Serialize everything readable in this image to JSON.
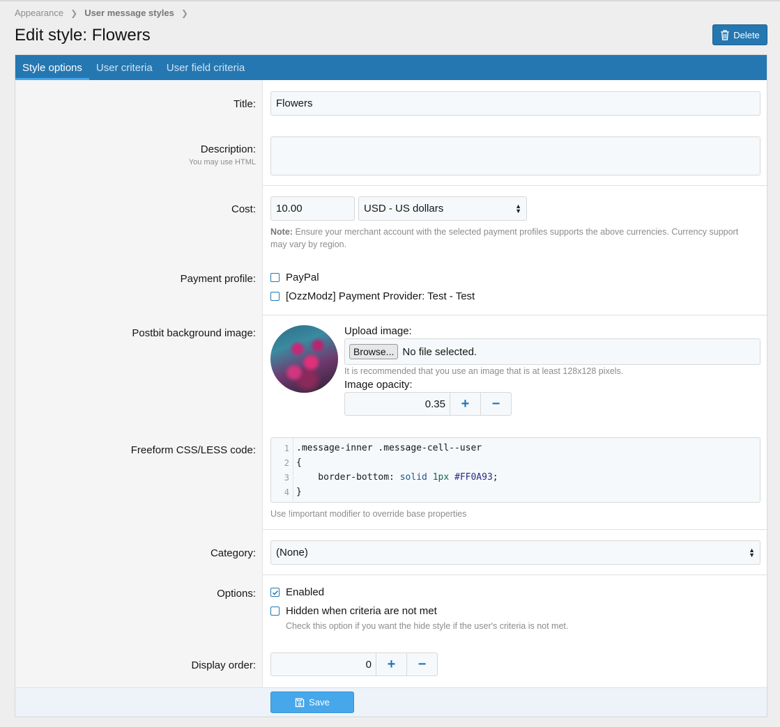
{
  "breadcrumb": {
    "items": [
      "Appearance",
      "User message styles"
    ]
  },
  "page": {
    "title": "Edit style: Flowers",
    "delete_label": "Delete"
  },
  "tabs": [
    "Style options",
    "User criteria",
    "User field criteria"
  ],
  "form": {
    "title": {
      "label": "Title:",
      "value": "Flowers"
    },
    "description": {
      "label": "Description:",
      "sublabel": "You may use HTML",
      "value": ""
    },
    "cost": {
      "label": "Cost:",
      "value": "10.00",
      "currency": "USD - US dollars",
      "note_bold": "Note:",
      "note": "Ensure your merchant account with the selected payment profiles supports the above currencies. Currency support may vary by region."
    },
    "payment_profile": {
      "label": "Payment profile:",
      "options": [
        {
          "label": "PayPal",
          "checked": false
        },
        {
          "label": "[OzzModz] Payment Provider: Test - Test",
          "checked": false
        }
      ]
    },
    "postbit": {
      "label": "Postbit background image:",
      "upload_label": "Upload image:",
      "browse_label": "Browse...",
      "file_status": "No file selected.",
      "hint": "It is recommended that you use an image that is at least 128x128 pixels.",
      "opacity_label": "Image opacity:",
      "opacity_value": "0.35",
      "plus": "+",
      "minus": "−"
    },
    "css": {
      "label": "Freeform CSS/LESS code:",
      "line_numbers": [
        "1",
        "2",
        "3",
        "4"
      ],
      "line1": ".message-inner .message-cell--user",
      "line2": "{",
      "line3_prop": "    border-bottom: ",
      "line3_val": "solid",
      "line3_num": "1px",
      "line3_color": "#FF0A93",
      "line3_end": ";",
      "line4": "}",
      "hint": "Use !important modifier to override base properties"
    },
    "category": {
      "label": "Category:",
      "value": "(None)"
    },
    "options": {
      "label": "Options:",
      "enabled": {
        "label": "Enabled",
        "checked": true
      },
      "hidden": {
        "label": "Hidden when criteria are not met",
        "checked": false,
        "hint": "Check this option if you want the hide style if the user's criteria is not met."
      }
    },
    "display_order": {
      "label": "Display order:",
      "value": "0"
    }
  },
  "footer": {
    "save_label": "Save"
  },
  "colors": {
    "accent": "#2577b1",
    "tab_highlight": "#47a7eb",
    "save": "#47a7eb"
  }
}
